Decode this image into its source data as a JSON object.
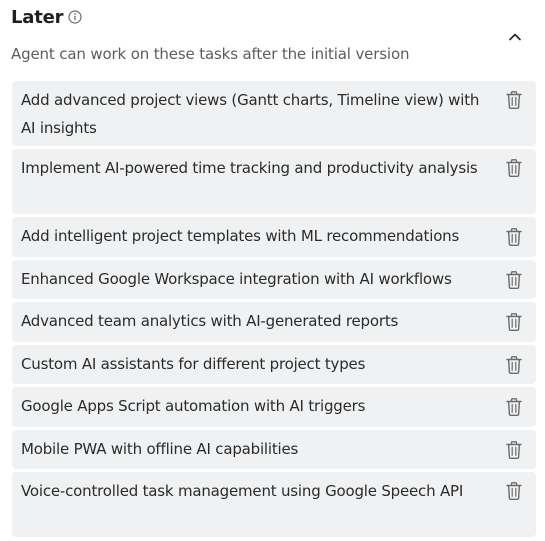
{
  "section": {
    "title": "Later",
    "info_icon": "info-circle-icon",
    "collapse_icon": "chevron-up-icon",
    "subtitle": "Agent can work on these tasks after the initial version"
  },
  "tasks": [
    {
      "text": "Add advanced project views (Gantt charts, Timeline view) with AI insights",
      "lines": 2
    },
    {
      "text": "Implement AI-powered time tracking and productivity analysis",
      "lines": 2
    },
    {
      "text": "Add intelligent project templates with ML recommendations",
      "lines": 1
    },
    {
      "text": "Enhanced Google Workspace integration with AI workflows",
      "lines": 1
    },
    {
      "text": "Advanced team analytics with AI-generated reports",
      "lines": 1
    },
    {
      "text": "Custom AI assistants for different project types",
      "lines": 1
    },
    {
      "text": "Google Apps Script automation with AI triggers",
      "lines": 1
    },
    {
      "text": "Mobile PWA with offline AI capabilities",
      "lines": 1
    },
    {
      "text": "Voice-controlled task management using Google Speech API",
      "lines": 2
    }
  ],
  "delete_icon": "trash-icon",
  "colors": {
    "task_background": "#f0f1f2",
    "icon": "#6b6b6b",
    "subtitle": "#5d5d5d"
  }
}
